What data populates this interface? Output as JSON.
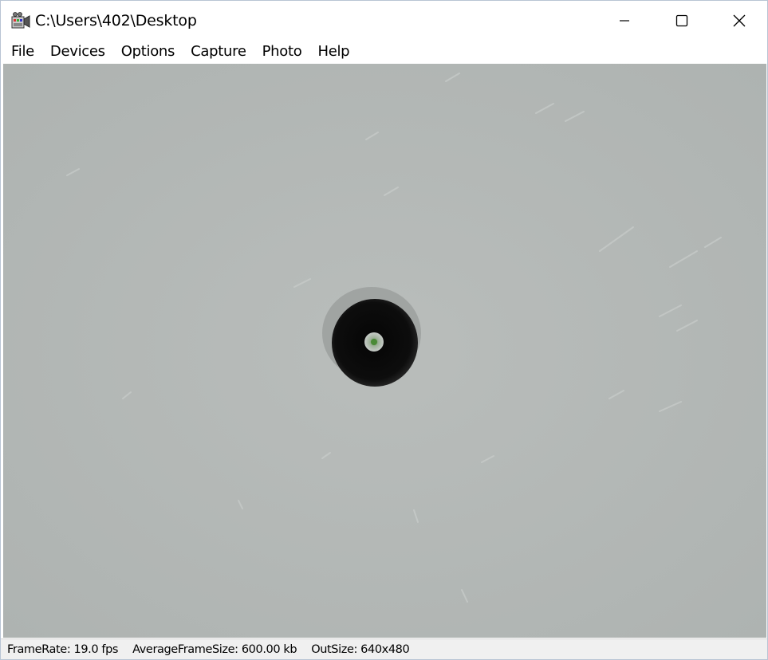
{
  "window": {
    "title": "C:\\Users\\402\\Desktop",
    "icon": "video-camera-icon"
  },
  "menu": {
    "items": [
      {
        "label": "File"
      },
      {
        "label": "Devices"
      },
      {
        "label": "Options"
      },
      {
        "label": "Capture"
      },
      {
        "label": "Photo"
      },
      {
        "label": "Help"
      }
    ]
  },
  "status": {
    "frame_rate": "FrameRate: 19.0 fps",
    "average_frame_size": "AverageFrameSize: 600.00 kb",
    "out_size": "OutSize: 640x480"
  },
  "colors": {
    "video_background": "#b4b8b6",
    "hole": "#0a0a0a",
    "center_dot": "#5a8a4a"
  }
}
